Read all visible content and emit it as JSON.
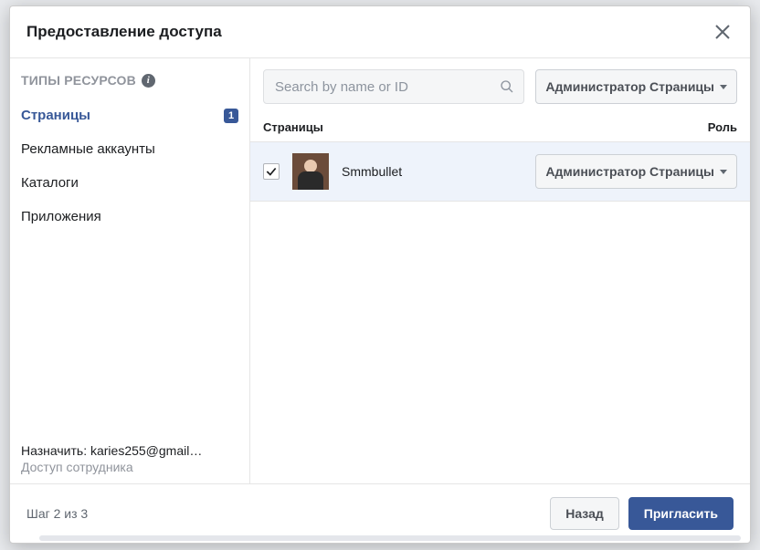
{
  "modal": {
    "title": "Предоставление доступа"
  },
  "sidebar": {
    "heading": "ТИПЫ РЕСУРСОВ",
    "items": [
      {
        "label": "Страницы",
        "badge": "1",
        "active": true
      },
      {
        "label": "Рекламные аккаунты"
      },
      {
        "label": "Каталоги"
      },
      {
        "label": "Приложения"
      }
    ],
    "assign_label": "Назначить: karies255@gmail…",
    "access_label": "Доступ сотрудника"
  },
  "main": {
    "search_placeholder": "Search by name or ID",
    "role_dropdown": "Администратор Страницы",
    "columns": {
      "name": "Страницы",
      "role": "Роль"
    },
    "rows": [
      {
        "checked": true,
        "name": "Smmbullet",
        "role": "Администратор Страницы"
      }
    ]
  },
  "footer": {
    "step": "Шаг 2 из 3",
    "back": "Назад",
    "invite": "Пригласить"
  }
}
